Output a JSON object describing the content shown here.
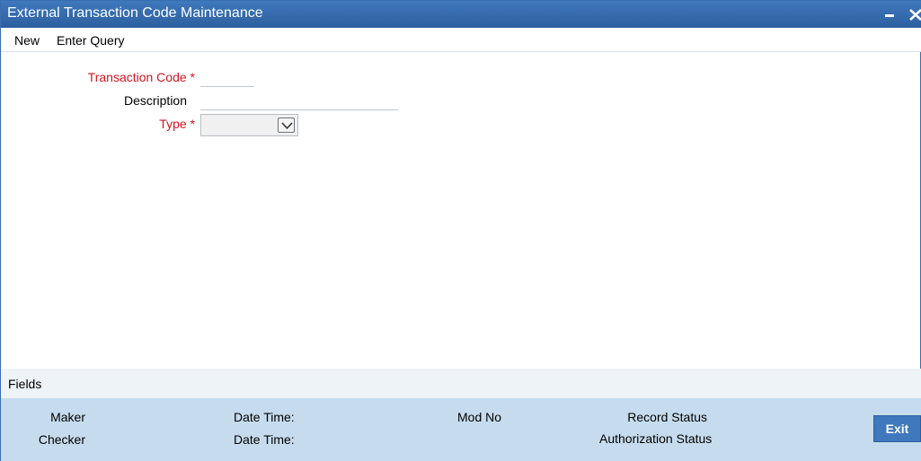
{
  "window": {
    "title": "External Transaction Code Maintenance",
    "minimize_icon": "minimize-icon",
    "close_icon": "close-icon"
  },
  "toolbar": {
    "new_label": "New",
    "enter_query_label": "Enter Query"
  },
  "form": {
    "transaction_code_label": "Transaction Code",
    "transaction_code_value": "",
    "description_label": "Description",
    "description_value": "",
    "type_label": "Type",
    "type_value": "",
    "required_marker": "*",
    "dropdown_icon": "chevron-down-icon"
  },
  "footer": {
    "fields_label": "Fields",
    "maker_label": "Maker",
    "checker_label": "Checker",
    "maker_datetime_label": "Date Time:",
    "checker_datetime_label": "Date Time:",
    "mod_no_label": "Mod No",
    "record_status_label": "Record Status",
    "authorization_status_label": "Authorization Status",
    "exit_label": "Exit"
  },
  "colors": {
    "titlebar": "#3f78bd",
    "required_label": "#d2141e",
    "audit_panel": "#c6dcee",
    "exit_button": "#3f78bd"
  }
}
